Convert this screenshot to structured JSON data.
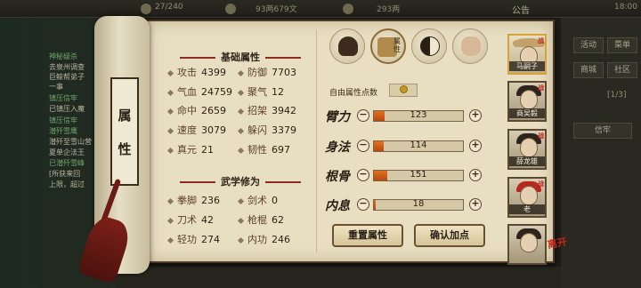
{
  "topbar": {
    "energy": "27/240",
    "silver": "93两679文",
    "gold": "293两",
    "notice": "公告",
    "time": "18:00"
  },
  "quest_log": {
    "lines": [
      "神秘疑杀",
      "去泉州调查",
      "巨鲸帮弟子",
      "一事",
      "镇压信牢",
      "已镇压入魔",
      "镇压信牢",
      "潜歼雪鹰",
      "潜歼至雪山营",
      "夏单企法王",
      "已潜歼雪峰",
      "[所获来回",
      "上限，超过"
    ]
  },
  "right_menu": {
    "buttons": [
      "活动",
      "菜单",
      "商城",
      "社区",
      "信牢"
    ],
    "counter": "[1/3]",
    "panel_label": "信牢"
  },
  "scroll": {
    "title_chars": [
      "属",
      "性"
    ]
  },
  "basic": {
    "title": "基础属性",
    "stats": [
      {
        "label": "攻击",
        "value": "4399"
      },
      {
        "label": "防御",
        "value": "7703"
      },
      {
        "label": "气血",
        "value": "24759"
      },
      {
        "label": "聚气",
        "value": "12"
      },
      {
        "label": "命中",
        "value": "2659"
      },
      {
        "label": "招架",
        "value": "3942"
      },
      {
        "label": "速度",
        "value": "3079"
      },
      {
        "label": "躲闪",
        "value": "3379"
      },
      {
        "label": "真元",
        "value": "21"
      },
      {
        "label": "韧性",
        "value": "697"
      }
    ]
  },
  "martial": {
    "title": "武学修为",
    "stats": [
      {
        "label": "拳脚",
        "value": "236"
      },
      {
        "label": "剑术",
        "value": "0"
      },
      {
        "label": "刀术",
        "value": "42"
      },
      {
        "label": "枪棍",
        "value": "62"
      },
      {
        "label": "轻功",
        "value": "274"
      },
      {
        "label": "内功",
        "value": "246"
      }
    ]
  },
  "tabs": {
    "items": [
      {
        "icon": "character-icon",
        "char": ""
      },
      {
        "icon": "scroll-stats-icon",
        "char": "属性"
      },
      {
        "icon": "yin-yang-icon",
        "char": ""
      },
      {
        "icon": "meridian-body-icon",
        "char": ""
      }
    ]
  },
  "free_points": {
    "label": "自由属性点数",
    "value": ""
  },
  "attributes": [
    {
      "glyph": "臂力",
      "value": "123",
      "fill": 0.123
    },
    {
      "glyph": "身法",
      "value": "114",
      "fill": 0.114
    },
    {
      "glyph": "根骨",
      "value": "151",
      "fill": 0.151
    },
    {
      "glyph": "内息",
      "value": "18",
      "fill": 0.018
    }
  ],
  "buttons": {
    "reset": "重置属性",
    "confirm": "确认加点"
  },
  "party": [
    {
      "name": "马嗣子",
      "tag": "战",
      "selected": true
    },
    {
      "name": "商吴毅",
      "tag": "战",
      "selected": false
    },
    {
      "name": "薛龙雄",
      "tag": "战",
      "selected": false
    },
    {
      "name": "老",
      "tag": "战",
      "selected": false
    },
    {
      "name": "",
      "tag": "",
      "selected": false
    }
  ],
  "close_seal": "离开",
  "colors": {
    "parchment": "#e8dfc2",
    "bar_fill": "#d8601a",
    "accent_red": "#8c2a1e"
  }
}
